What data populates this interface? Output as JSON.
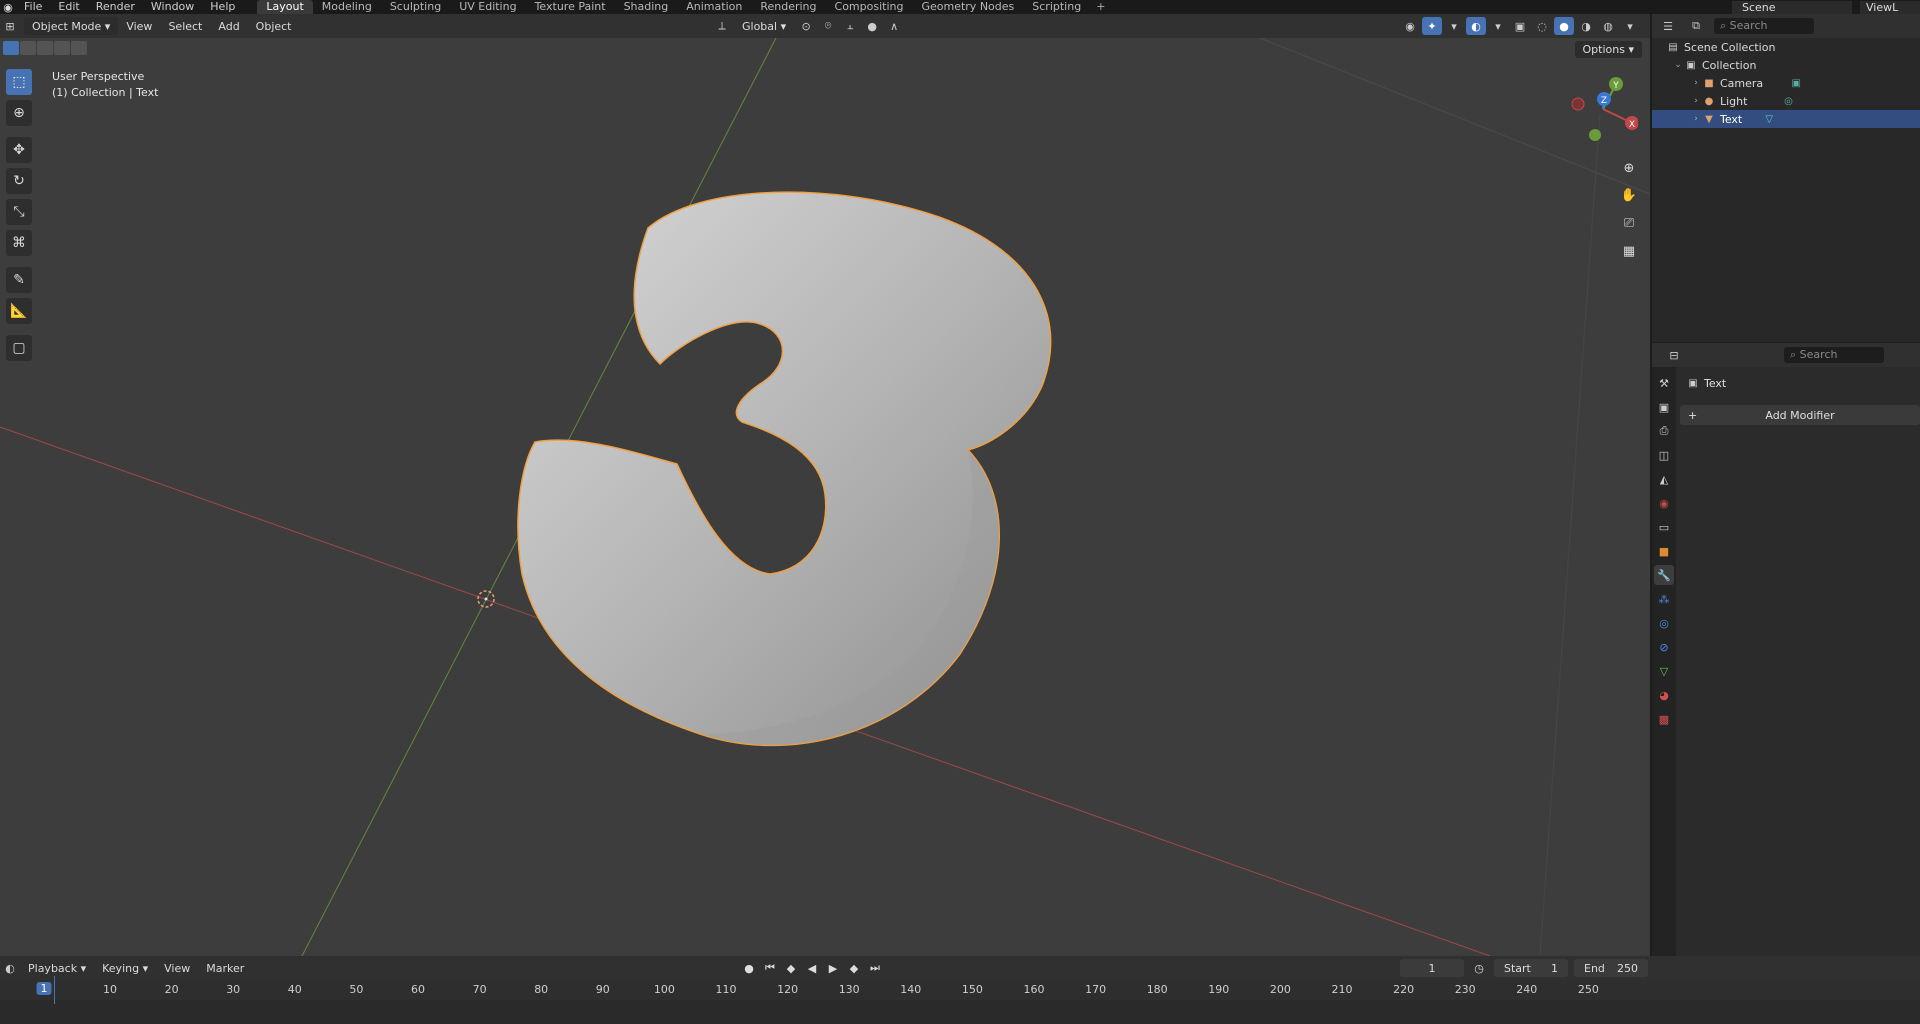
{
  "topbar": {
    "menus": [
      "File",
      "Edit",
      "Render",
      "Window",
      "Help"
    ],
    "workspaces": [
      "Layout",
      "Modeling",
      "Sculpting",
      "UV Editing",
      "Texture Paint",
      "Shading",
      "Animation",
      "Rendering",
      "Compositing",
      "Geometry Nodes",
      "Scripting"
    ],
    "active_workspace": "Layout",
    "scene": "Scene",
    "view_layer": "ViewL"
  },
  "viewport": {
    "mode": "Object Mode",
    "menus": [
      "View",
      "Select",
      "Add",
      "Object"
    ],
    "orientation": "Global",
    "options": "Options",
    "perspective": "User Perspective",
    "collection_info": "(1) Collection | Text",
    "gizmo_axes": [
      "X",
      "Y",
      "Z"
    ]
  },
  "outliner": {
    "search_placeholder": "Search",
    "scene_collection": "Scene Collection",
    "collection": "Collection",
    "objects": [
      {
        "name": "Camera",
        "icon": "camera-icon",
        "selected": false
      },
      {
        "name": "Light",
        "icon": "light-icon",
        "selected": false
      },
      {
        "name": "Text",
        "icon": "text-icon",
        "selected": true
      }
    ]
  },
  "properties": {
    "search_placeholder": "Search",
    "object_name": "Text",
    "add_modifier": "Add Modifier"
  },
  "timeline": {
    "menus": [
      "Playback",
      "Keying",
      "View",
      "Marker"
    ],
    "current_frame": "1",
    "start_label": "Start",
    "start": "1",
    "end_label": "End",
    "end": "250",
    "ruler_ticks": [
      "10",
      "20",
      "30",
      "40",
      "50",
      "60",
      "70",
      "80",
      "90",
      "100",
      "110",
      "120",
      "130",
      "140",
      "150",
      "160",
      "170",
      "180",
      "190",
      "200",
      "210",
      "220",
      "230",
      "240",
      "250"
    ]
  },
  "colors": {
    "accent": "#4772b3",
    "selection_outline": "#f0a040",
    "x_axis": "#c04848",
    "y_axis": "#6a9c3c",
    "z_axis": "#3a78d8"
  }
}
